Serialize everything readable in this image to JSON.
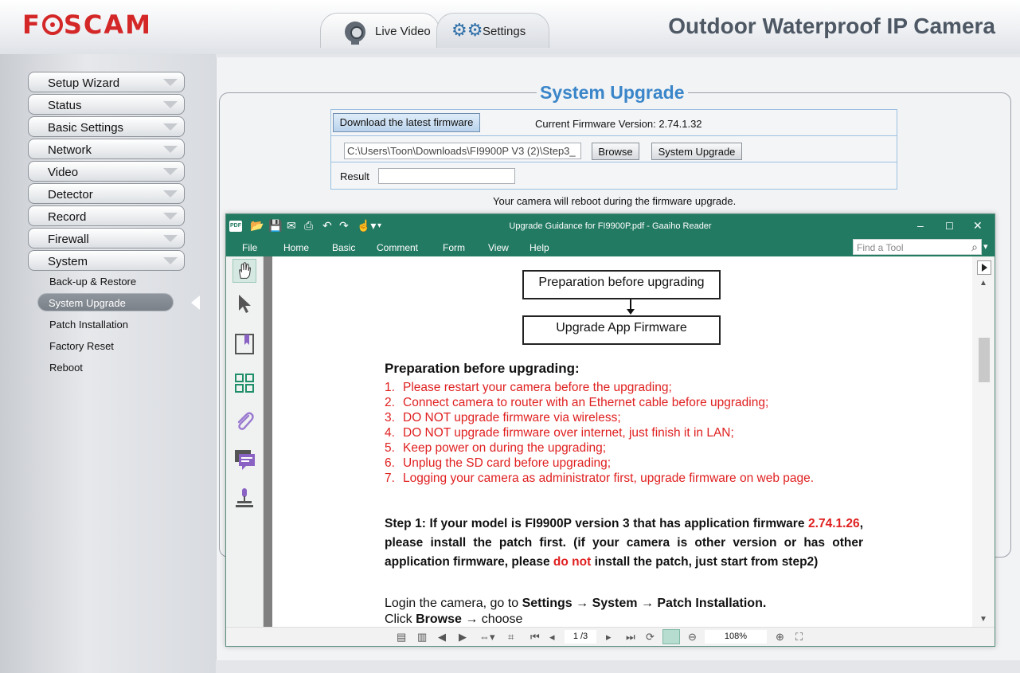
{
  "header": {
    "logo": "FOSCAM",
    "product_title": "Outdoor Waterproof IP Camera",
    "tabs": [
      {
        "label": "Live Video",
        "icon": "webcam-icon"
      },
      {
        "label": "Settings",
        "icon": "gears-icon"
      }
    ]
  },
  "sidebar": {
    "menu": [
      "Setup Wizard",
      "Status",
      "Basic Settings",
      "Network",
      "Video",
      "Detector",
      "Record",
      "Firewall",
      "System"
    ],
    "submenu": [
      "Back-up & Restore",
      "System Upgrade",
      "Patch Installation",
      "Factory Reset",
      "Reboot"
    ],
    "active_submenu": "System Upgrade"
  },
  "upgrade": {
    "title": "System Upgrade",
    "download_label": "Download the latest firmware",
    "current_version_label": "Current Firmware Version: 2.74.1.32",
    "file_path": "C:\\Users\\Toon\\Downloads\\FI9900P V3 (2)\\Step3_",
    "browse_label": "Browse",
    "upgrade_label": "System Upgrade",
    "result_label": "Result",
    "reboot_note": "Your camera will reboot during the firmware upgrade."
  },
  "reader": {
    "title": "Upgrade Guidance for FI9900P.pdf - Gaaiho Reader",
    "menu": [
      "File",
      "Home",
      "Basic",
      "Comment",
      "Form",
      "View",
      "Help"
    ],
    "find_placeholder": "Find a Tool",
    "page_indicator": "1 /3",
    "zoom": "108%",
    "document": {
      "flow_box_1": "Preparation before upgrading",
      "flow_box_2": "Upgrade App Firmware",
      "heading": "Preparation before upgrading:",
      "steps": [
        "Please restart your camera before the upgrading;",
        "Connect camera to router with an Ethernet cable before upgrading;",
        "DO NOT upgrade firmware via wireless;",
        "DO NOT upgrade firmware over internet, just finish it in LAN;",
        "Keep power on during the upgrading;",
        "Unplug the SD card before upgrading;",
        "Logging your camera as administrator first, upgrade firmware on web page."
      ],
      "step1_a": "Step 1: If your model is FI9900P version 3 that has application firmware ",
      "step1_version": "2.74.1.26",
      "step1_b": ", please install the patch first. (if your camera is other version or has other application firmware, please ",
      "step1_donot": "do not",
      "step1_c": " install the patch, just start from step2)",
      "login_a": "Login the camera, go to ",
      "login_path": "Settings → System → Patch Installation.",
      "click_a": "Click ",
      "click_browse": "Browse",
      "click_b": " → choose"
    }
  },
  "colors": {
    "brand_red": "#d42727",
    "title_blue": "#3a86c9",
    "reader_green": "#237a62",
    "instruction_red": "#e02020"
  }
}
